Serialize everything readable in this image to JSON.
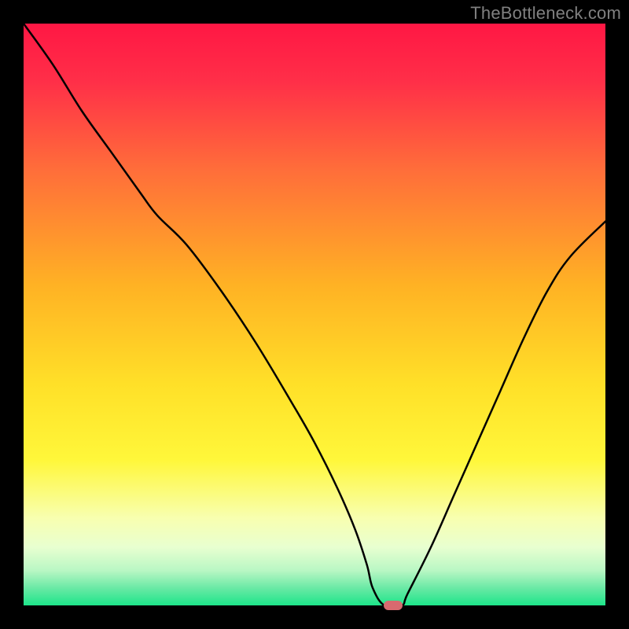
{
  "watermark": "TheBottleneck.com",
  "chart_data": {
    "type": "line",
    "title": "",
    "xlabel": "",
    "ylabel": "",
    "xlim": [
      0,
      100
    ],
    "ylim": [
      0,
      100
    ],
    "background": {
      "type": "vertical-gradient",
      "stops": [
        {
          "pos": 0.0,
          "color": "#ff1744"
        },
        {
          "pos": 0.1,
          "color": "#ff2f48"
        },
        {
          "pos": 0.25,
          "color": "#ff6d3a"
        },
        {
          "pos": 0.45,
          "color": "#ffb224"
        },
        {
          "pos": 0.62,
          "color": "#ffe028"
        },
        {
          "pos": 0.75,
          "color": "#fff73a"
        },
        {
          "pos": 0.85,
          "color": "#f8ffb0"
        },
        {
          "pos": 0.9,
          "color": "#e8ffd0"
        },
        {
          "pos": 0.94,
          "color": "#b9f7c4"
        },
        {
          "pos": 0.97,
          "color": "#6ae9a5"
        },
        {
          "pos": 1.0,
          "color": "#1de58a"
        }
      ]
    },
    "series": [
      {
        "name": "bottleneck-curve",
        "color": "#000000",
        "x": [
          0,
          5,
          10,
          15,
          20,
          23,
          28,
          34,
          40,
          46,
          50,
          54,
          57,
          59,
          60,
          62,
          65,
          66,
          70,
          74,
          78,
          82,
          86,
          90,
          94,
          100
        ],
        "y": [
          100,
          93,
          85,
          78,
          71,
          67,
          62,
          54,
          45,
          35,
          28,
          20,
          13,
          7,
          3,
          0,
          0,
          2,
          10,
          19,
          28,
          37,
          46,
          54,
          60,
          66
        ]
      }
    ],
    "marker": {
      "name": "optimal-point",
      "shape": "rounded-rect",
      "color": "#d86a6f",
      "x": 63.5,
      "y": 0,
      "width_pct": 3.2,
      "height_pct": 1.6
    }
  }
}
